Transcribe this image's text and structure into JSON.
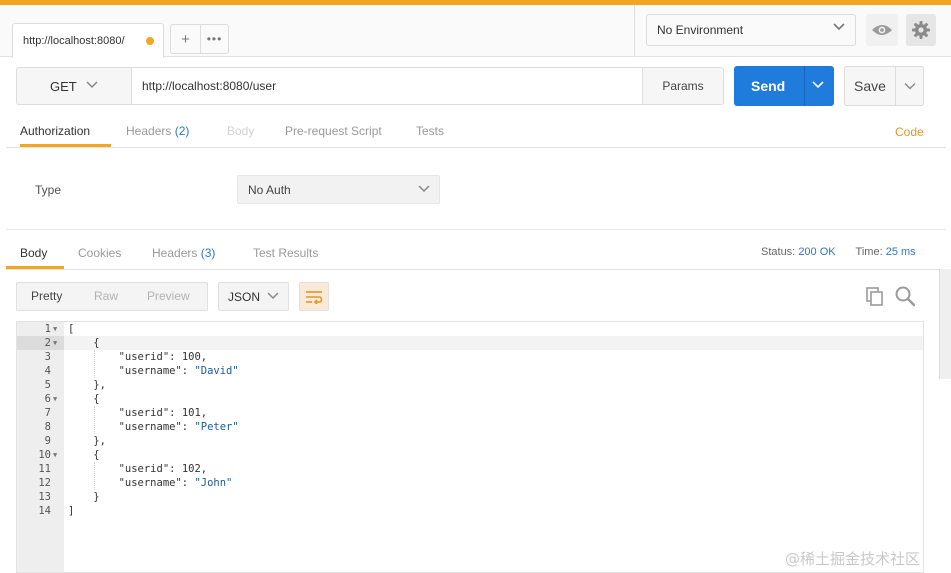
{
  "tabs": {
    "active_tab_label": "http://localhost:8080/",
    "new_tab_label": "+",
    "more_label": "•••"
  },
  "environment": {
    "selected": "No Environment"
  },
  "request": {
    "method": "GET",
    "url": "http://localhost:8080/user",
    "params_label": "Params",
    "send_label": "Send",
    "save_label": "Save"
  },
  "request_tabs": {
    "authorization": "Authorization",
    "headers": "Headers",
    "headers_count": "(2)",
    "body": "Body",
    "prerequest": "Pre-request Script",
    "tests": "Tests",
    "code": "Code"
  },
  "auth": {
    "type_label": "Type",
    "type_value": "No Auth"
  },
  "response_tabs": {
    "body": "Body",
    "cookies": "Cookies",
    "headers": "Headers",
    "headers_count": "(3)",
    "test_results": "Test Results"
  },
  "status": {
    "status_label": "Status:",
    "status_value": "200 OK",
    "time_label": "Time:",
    "time_value": "25 ms"
  },
  "view": {
    "pretty": "Pretty",
    "raw": "Raw",
    "preview": "Preview",
    "format": "JSON"
  },
  "response_lines": [
    {
      "num": "1",
      "text": "["
    },
    {
      "num": "2",
      "text": "    {"
    },
    {
      "num": "3",
      "key": "        \"userid\"",
      "sep": ": ",
      "val": "100",
      "end": ","
    },
    {
      "num": "4",
      "key": "        \"username\"",
      "sep": ": ",
      "str": "\"David\"",
      "end": ""
    },
    {
      "num": "5",
      "text": "    },"
    },
    {
      "num": "6",
      "text": "    {"
    },
    {
      "num": "7",
      "key": "        \"userid\"",
      "sep": ": ",
      "val": "101",
      "end": ","
    },
    {
      "num": "8",
      "key": "        \"username\"",
      "sep": ": ",
      "str": "\"Peter\"",
      "end": ""
    },
    {
      "num": "9",
      "text": "    },"
    },
    {
      "num": "10",
      "text": "    {"
    },
    {
      "num": "11",
      "key": "        \"userid\"",
      "sep": ": ",
      "val": "102",
      "end": ","
    },
    {
      "num": "12",
      "key": "        \"username\"",
      "sep": ": ",
      "str": "\"John\"",
      "end": ""
    },
    {
      "num": "13",
      "text": "    }"
    },
    {
      "num": "14",
      "text": "]"
    }
  ],
  "foldable_lines": [
    "1",
    "2",
    "6",
    "10"
  ],
  "watermark": "@稀土掘金技术社区",
  "colors": {
    "accent": "#f4a623",
    "send": "#1f7bdc",
    "link": "#2d78c6",
    "code_link": "#e8932a"
  }
}
